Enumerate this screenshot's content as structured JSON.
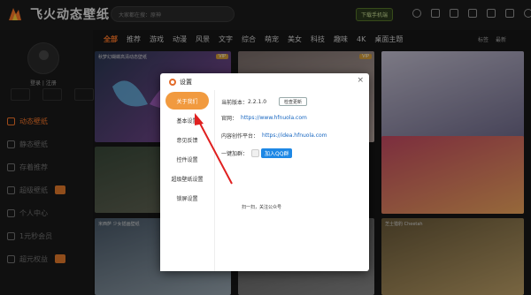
{
  "app": {
    "name": "飞火动态壁纸",
    "search_placeholder": "大家都在搜：原神",
    "top_button": "下载手机端"
  },
  "sidebar": {
    "login_label": "登录 | 注册",
    "sub_buttons": [
      "",
      "",
      ""
    ],
    "items": [
      {
        "label": "动态壁纸",
        "active": true
      },
      {
        "label": "静态壁纸",
        "active": false
      },
      {
        "label": "存着推荐",
        "active": false
      },
      {
        "label": "超级壁纸",
        "active": false
      },
      {
        "label": "个人中心",
        "active": false
      },
      {
        "label": "1元秒会员",
        "active": false
      },
      {
        "label": "超元权益",
        "active": false
      }
    ]
  },
  "categories": [
    "全部",
    "推荐",
    "游戏",
    "动漫",
    "风景",
    "文字",
    "综合",
    "萌宠",
    "美女",
    "科技",
    "趣味",
    "4K",
    "桌面主题"
  ],
  "category_right": [
    "标签",
    "最新"
  ],
  "tiles": [
    {
      "caption": "秋梦幻蝴蝶高清动态壁纸",
      "vip": "VIP",
      "color_a": "#2b3a55",
      "color_b": "#8a4a9e"
    },
    {
      "caption": "",
      "vip": "VIP",
      "color_a": "#7a6d6a",
      "color_b": "#c9b7b0"
    },
    {
      "caption": "",
      "vip": "",
      "color_a": "#c8c4d6",
      "color_b": "#6f6a8c"
    },
    {
      "caption": "",
      "vip": "",
      "color_a": "#3a4a3a",
      "color_b": "#6a6a5a"
    },
    {
      "caption": "",
      "vip": "",
      "color_a": "#c84a64",
      "color_b": "#f2a95e"
    },
    {
      "caption": "米西萨 少女插画壁纸",
      "vip": "",
      "color_a": "#4a5a6a",
      "color_b": "#9aa8b2"
    },
    {
      "caption": "",
      "vip": "",
      "color_a": "#5a5a5a",
      "color_b": "#8a8a8a"
    },
    {
      "caption": "芝士猎豹 Cheetah",
      "vip": "",
      "color_a": "#6a5a3a",
      "color_b": "#c2a46a"
    }
  ],
  "dialog": {
    "title": "设置",
    "close": "×",
    "tabs": [
      "关于我们",
      "基本设置",
      "意见反馈",
      "控件设置",
      "超级壁纸设置",
      "锁屏设置"
    ],
    "version_label": "当前版本：",
    "version": "2.2.1.0",
    "check_update": "检查更新",
    "site_label": "官网：",
    "site_url": "https://www.hfnuola.com",
    "creator_label": "内容创作平台：",
    "creator_url": "https://idea.hfnuola.com",
    "group_label": "一键加群：",
    "group_button": "加入QQ群",
    "follow": "扫一扫，关注公众号"
  },
  "colors": {
    "accent": "#ff7a2a",
    "tab_active": "#f19a3f",
    "link": "#1565c0",
    "arrow": "#e02020"
  }
}
